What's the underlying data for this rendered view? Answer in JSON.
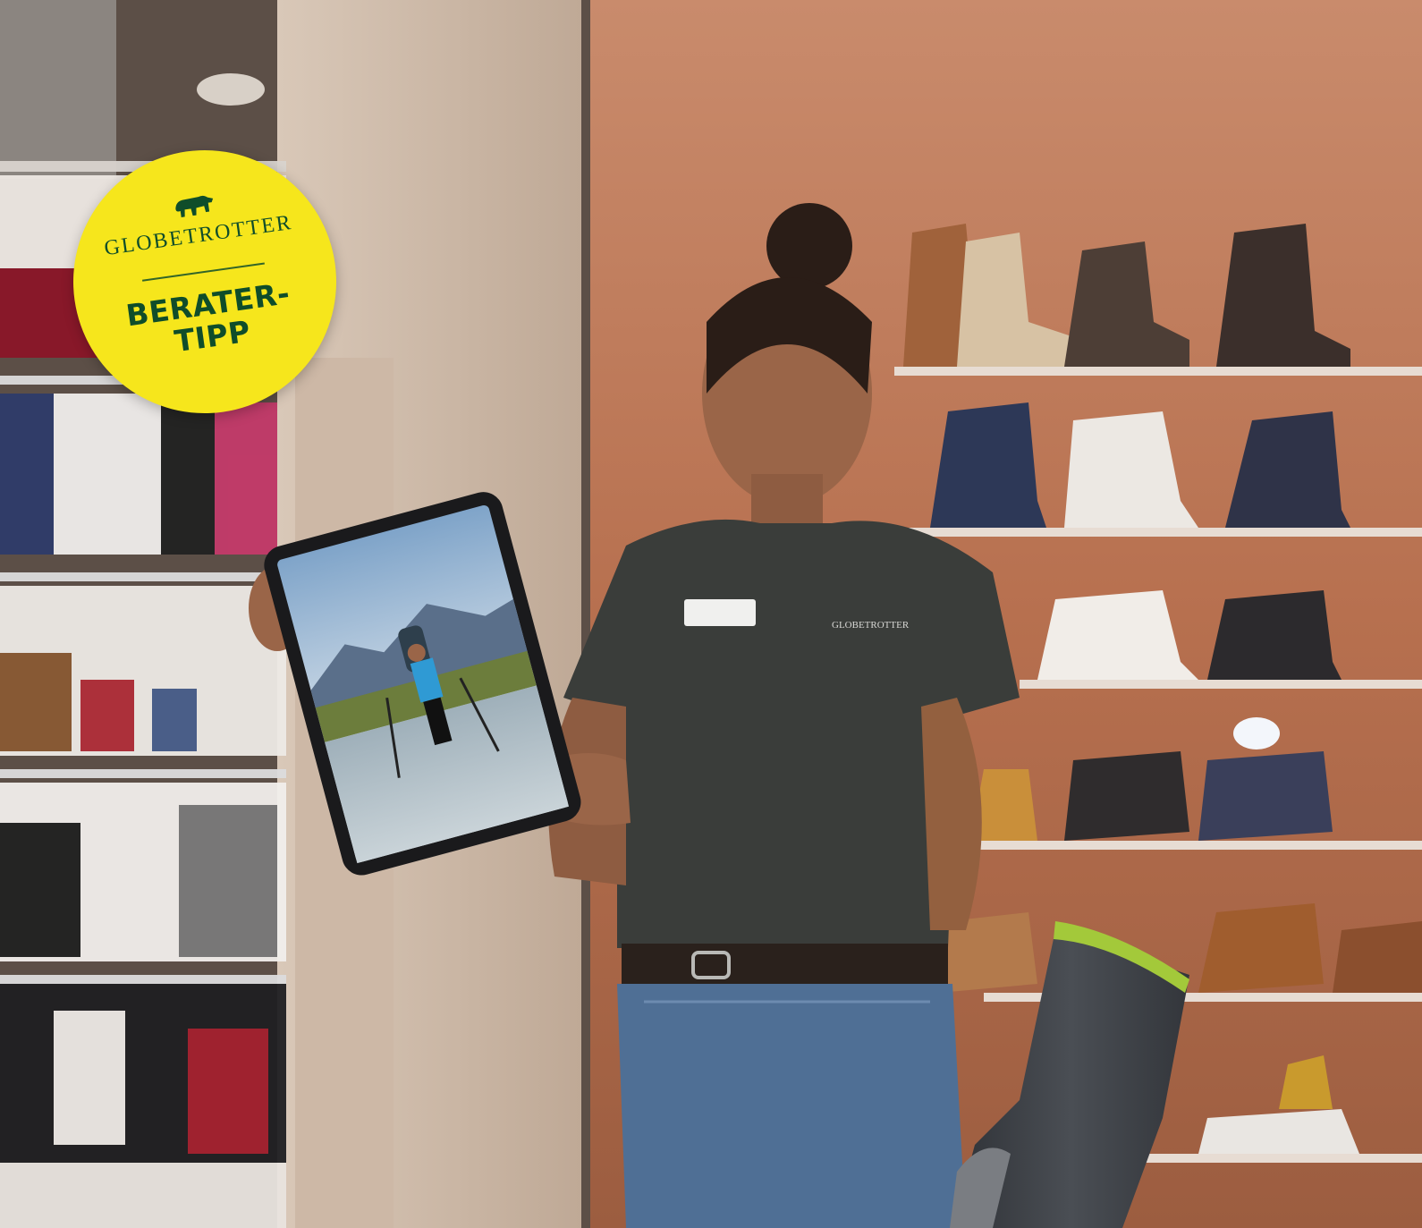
{
  "badge": {
    "brand": "GLOBETROTTER",
    "line1": "BERATER-",
    "line2": "TIPP",
    "background_color": "#f6e61c",
    "text_color": "#0f4d2a",
    "icon": "bear-icon"
  },
  "colors": {
    "brick_wall": "#b86f50",
    "shirt": "#3a3d3a",
    "jeans": "#4f6f95",
    "sock": "#3e4146",
    "sock_accent": "#a3c93a"
  }
}
